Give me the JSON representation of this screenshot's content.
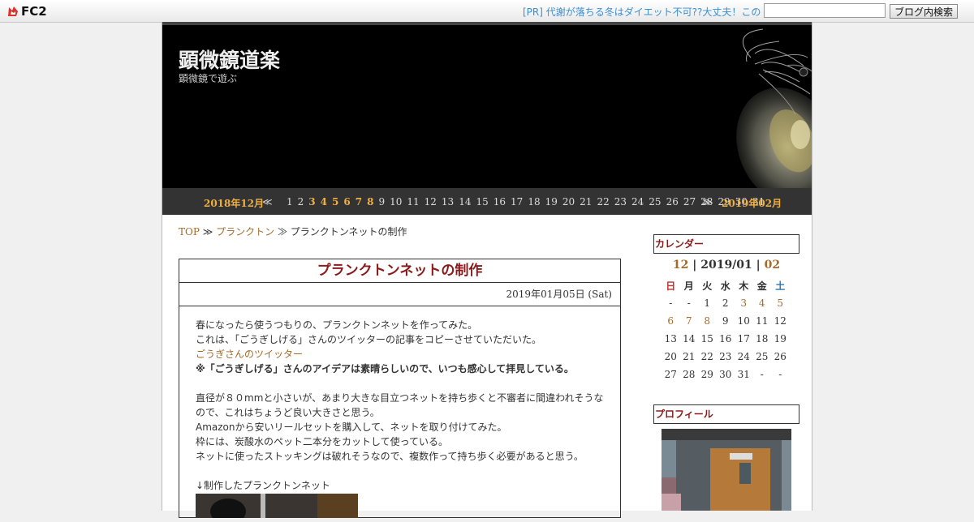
{
  "fc2": {
    "logo_text": "FC2",
    "pr_text": "[PR] 代謝が落ちる冬はダイエット不可??大丈夫！この",
    "search_placeholder": "",
    "search_button": "ブログ内検索"
  },
  "blog": {
    "title": "顕微鏡道楽",
    "subtitle": "顕微鏡で遊ぶ"
  },
  "archive_nav": {
    "prev_month": "2018年12月",
    "prev_arrow": "≪",
    "next_arrow": "≫",
    "next_month": "2019年02月",
    "days": [
      {
        "d": "1",
        "has": false
      },
      {
        "d": "2",
        "has": false
      },
      {
        "d": "3",
        "has": true
      },
      {
        "d": "4",
        "has": true
      },
      {
        "d": "5",
        "has": true
      },
      {
        "d": "6",
        "has": true
      },
      {
        "d": "7",
        "has": true
      },
      {
        "d": "8",
        "has": true
      },
      {
        "d": "9",
        "has": false
      },
      {
        "d": "10",
        "has": false
      },
      {
        "d": "11",
        "has": false
      },
      {
        "d": "12",
        "has": false
      },
      {
        "d": "13",
        "has": false
      },
      {
        "d": "14",
        "has": false
      },
      {
        "d": "15",
        "has": false
      },
      {
        "d": "16",
        "has": false
      },
      {
        "d": "17",
        "has": false
      },
      {
        "d": "18",
        "has": false
      },
      {
        "d": "19",
        "has": false
      },
      {
        "d": "20",
        "has": false
      },
      {
        "d": "21",
        "has": false
      },
      {
        "d": "22",
        "has": false
      },
      {
        "d": "23",
        "has": false
      },
      {
        "d": "24",
        "has": false
      },
      {
        "d": "25",
        "has": false
      },
      {
        "d": "26",
        "has": false
      },
      {
        "d": "27",
        "has": false
      },
      {
        "d": "28",
        "has": false
      },
      {
        "d": "29",
        "has": false
      },
      {
        "d": "30",
        "has": false
      },
      {
        "d": "31",
        "has": false
      }
    ]
  },
  "breadcrumb": {
    "top": "TOP",
    "sep1": " ≫ ",
    "category": "プランクトン",
    "sep2": " ≫ ",
    "current": "プランクトンネットの制作"
  },
  "entry": {
    "title": "プランクトンネットの制作",
    "date": "2019年01月05日 (Sat)",
    "lines": [
      "春になったら使うつもりの、プランクトンネットを作ってみた。",
      "これは、「ごうぎしげる」さんのツイッターの記事をコピーさせていただいた。"
    ],
    "twitter_link": "ごうぎさんのツイッター",
    "bold_note": "※「ごうぎしげる」さんのアイデアは素晴らしいので、いつも感心して拝見している。",
    "paragraph2": [
      "直径が８０mmと小さいが、あまり大きな目立つネットを持ち歩くと不審者に間違われそうな",
      "ので、これはちょうど良い大きさと思う。",
      "Amazonから安いリールセットを購入して、ネットを取り付けてみた。",
      "枠には、炭酸水のペット二本分をカットして使っている。",
      "ネットに使ったストッキングは破れそうなので、複数作って持ち歩く必要があると思う。"
    ],
    "photo_caption": "↓制作したプランクトンネット"
  },
  "calendar": {
    "heading": "カレンダー",
    "prev": "12",
    "sep": " | ",
    "current": "2019/01",
    "next": "02",
    "weekdays": [
      "日",
      "月",
      "火",
      "水",
      "木",
      "金",
      "土"
    ],
    "weeks": [
      [
        {
          "t": "-"
        },
        {
          "t": "-"
        },
        {
          "t": "1"
        },
        {
          "t": "2"
        },
        {
          "t": "3",
          "link": true
        },
        {
          "t": "4",
          "link": true
        },
        {
          "t": "5",
          "link": true
        }
      ],
      [
        {
          "t": "6",
          "link": true
        },
        {
          "t": "7",
          "link": true
        },
        {
          "t": "8",
          "link": true
        },
        {
          "t": "9"
        },
        {
          "t": "10"
        },
        {
          "t": "11"
        },
        {
          "t": "12"
        }
      ],
      [
        {
          "t": "13"
        },
        {
          "t": "14"
        },
        {
          "t": "15"
        },
        {
          "t": "16"
        },
        {
          "t": "17"
        },
        {
          "t": "18"
        },
        {
          "t": "19"
        }
      ],
      [
        {
          "t": "20"
        },
        {
          "t": "21"
        },
        {
          "t": "22"
        },
        {
          "t": "23"
        },
        {
          "t": "24"
        },
        {
          "t": "25"
        },
        {
          "t": "26"
        }
      ],
      [
        {
          "t": "27"
        },
        {
          "t": "28"
        },
        {
          "t": "29"
        },
        {
          "t": "30"
        },
        {
          "t": "31"
        },
        {
          "t": "-"
        },
        {
          "t": "-"
        }
      ]
    ]
  },
  "profile": {
    "heading": "プロフィール"
  },
  "colors": {
    "link": "#a56a2a",
    "title_red": "#8b1a1a",
    "nav_gold": "#f0b040",
    "pr_blue": "#3a8fd4"
  }
}
